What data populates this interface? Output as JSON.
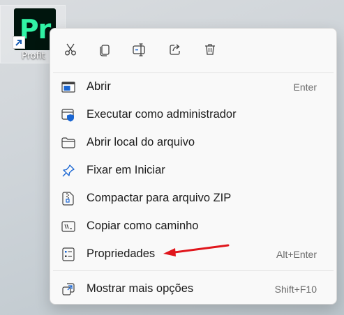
{
  "desktop": {
    "shortcut_label": "Profit",
    "app_tile_text": "Pr",
    "app_tile_color": "#31f4a6"
  },
  "context_menu": {
    "quick_actions": [
      "cut-icon",
      "copy-icon",
      "rename-icon",
      "share-icon",
      "delete-icon"
    ],
    "items": [
      {
        "label": "Abrir",
        "shortcut": "Enter",
        "icon": "open-window-icon"
      },
      {
        "label": "Executar como administrador",
        "shortcut": "",
        "icon": "admin-shield-icon"
      },
      {
        "label": "Abrir local do arquivo",
        "shortcut": "",
        "icon": "folder-icon"
      },
      {
        "label": "Fixar em Iniciar",
        "shortcut": "",
        "icon": "pin-icon"
      },
      {
        "label": "Compactar para arquivo ZIP",
        "shortcut": "",
        "icon": "zip-icon"
      },
      {
        "label": "Copiar como caminho",
        "shortcut": "",
        "icon": "copy-path-icon"
      },
      {
        "label": "Propriedades",
        "shortcut": "Alt+Enter",
        "icon": "properties-icon"
      }
    ],
    "more_options": {
      "label": "Mostrar mais opções",
      "shortcut": "Shift+F10",
      "icon": "more-options-icon"
    }
  },
  "annotation": {
    "color": "#e0161c",
    "target": "Propriedades"
  }
}
